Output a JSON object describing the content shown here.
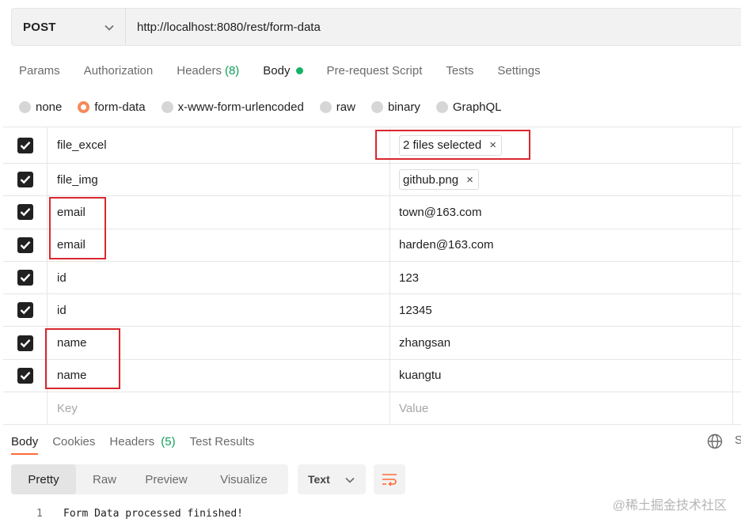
{
  "request": {
    "method": "POST",
    "url": "http://localhost:8080/rest/form-data"
  },
  "request_tabs": [
    {
      "label": "Params"
    },
    {
      "label": "Authorization"
    },
    {
      "label": "Headers",
      "count": "(8)"
    },
    {
      "label": "Body"
    },
    {
      "label": "Pre-request Script"
    },
    {
      "label": "Tests"
    },
    {
      "label": "Settings"
    }
  ],
  "body_types": [
    {
      "label": "none"
    },
    {
      "label": "form-data"
    },
    {
      "label": "x-www-form-urlencoded"
    },
    {
      "label": "raw"
    },
    {
      "label": "binary"
    },
    {
      "label": "GraphQL"
    }
  ],
  "form_rows": [
    {
      "key": "file_excel",
      "value": "2 files selected",
      "chip_close": "×"
    },
    {
      "key": "file_img",
      "value": "github.png",
      "chip_close": "×"
    },
    {
      "key": "email",
      "value": "town@163.com"
    },
    {
      "key": "email",
      "value": "harden@163.com"
    },
    {
      "key": "id",
      "value": "123"
    },
    {
      "key": "id",
      "value": "12345"
    },
    {
      "key": "name",
      "value": "zhangsan"
    },
    {
      "key": "name",
      "value": "kuangtu"
    }
  ],
  "empty_row": {
    "key_placeholder": "Key",
    "value_placeholder": "Value"
  },
  "response_tabs": [
    {
      "label": "Body"
    },
    {
      "label": "Cookies"
    },
    {
      "label": "Headers",
      "count": "(5)"
    },
    {
      "label": "Test Results"
    }
  ],
  "response_tabs_truncated": "S",
  "view_modes": [
    {
      "label": "Pretty"
    },
    {
      "label": "Raw"
    },
    {
      "label": "Preview"
    },
    {
      "label": "Visualize"
    }
  ],
  "format_select": "Text",
  "response_body": {
    "line_number": "1",
    "text": "Form Data processed finished!"
  },
  "watermark": "@稀土掘金技术社区",
  "colors": {
    "accent": "#ff6c37",
    "active_dot": "#16b364",
    "highlight_box": "#d9272e",
    "checkbox": "#212121"
  },
  "icons": {
    "method_dropdown": "chevron-down-icon",
    "checkbox": "checkmark-icon",
    "chip_close": "close-icon",
    "globe": "globe-icon",
    "format_dropdown": "chevron-down-icon",
    "wrap": "wrap-lines-icon"
  }
}
